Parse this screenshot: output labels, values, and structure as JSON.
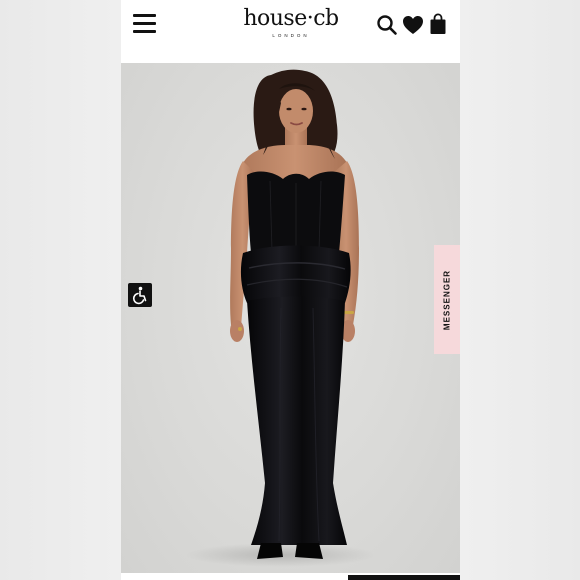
{
  "header": {
    "brand_name": "house·cb",
    "brand_sub": "LONDON",
    "menu_icon": "hamburger-menu-icon",
    "search_icon": "search-icon",
    "wishlist_icon": "heart-icon",
    "bag_icon": "shopping-bag-icon"
  },
  "hero": {
    "subject": "model-in-black-strapless-corset-maxi-dress"
  },
  "widgets": {
    "accessibility_icon": "accessibility-wheelchair-icon",
    "messenger_label": "MESSENGER"
  },
  "colors": {
    "brand_text": "#111111",
    "hero_background": "#d9d9d7",
    "messenger_tab": "#f6d9db",
    "dress": "#0c0c0e"
  }
}
